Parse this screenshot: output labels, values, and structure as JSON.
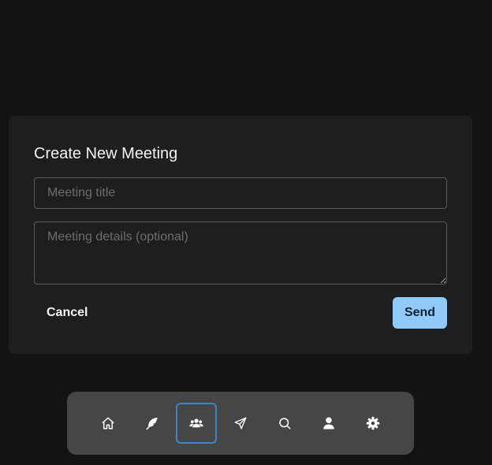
{
  "dialog": {
    "title": "Create New Meeting",
    "title_input": {
      "value": "",
      "placeholder": "Meeting title"
    },
    "details_input": {
      "value": "",
      "placeholder": "Meeting details (optional)"
    },
    "cancel_label": "Cancel",
    "send_label": "Send"
  },
  "nav": {
    "active": "meetings",
    "items": [
      {
        "id": "home",
        "icon": "home-icon"
      },
      {
        "id": "feather",
        "icon": "feather-icon"
      },
      {
        "id": "meetings",
        "icon": "users-icon"
      },
      {
        "id": "send",
        "icon": "send-icon"
      },
      {
        "id": "search",
        "icon": "search-icon"
      },
      {
        "id": "profile",
        "icon": "user-icon"
      },
      {
        "id": "settings",
        "icon": "gear-icon"
      }
    ]
  },
  "colors": {
    "background": "#131313",
    "dialog": "#1e1e20",
    "accent": "#90caf9",
    "nav_bar": "#464646",
    "active_border": "#3f84c4"
  }
}
